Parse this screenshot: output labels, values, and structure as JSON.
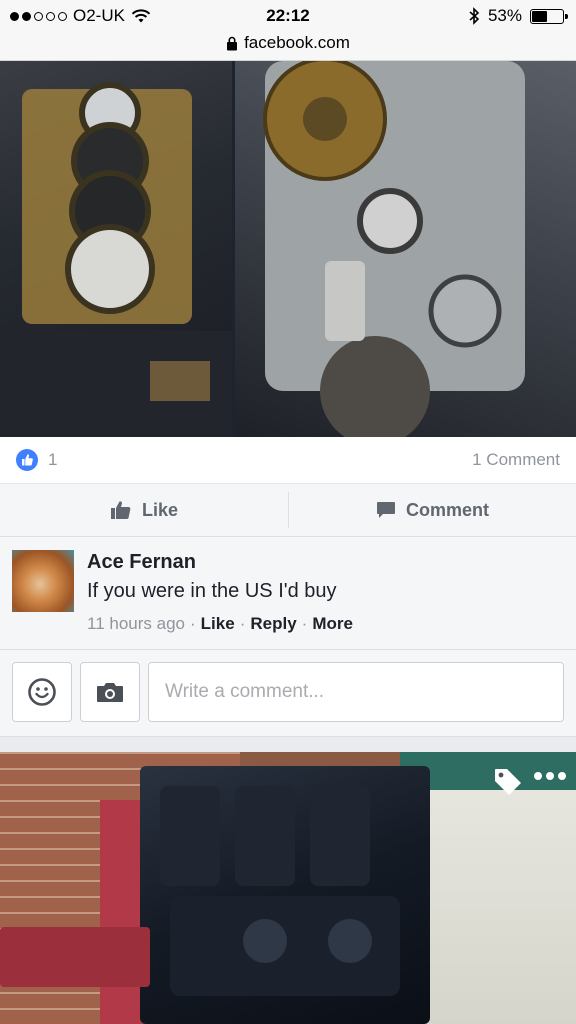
{
  "status_bar": {
    "carrier": "O2-UK",
    "signal_bars_filled": 2,
    "signal_bars_total": 5,
    "time": "22:12",
    "battery_percent": "53%",
    "battery_level": 0.53
  },
  "url_bar": {
    "domain": "facebook.com"
  },
  "post": {
    "reaction_count": "1",
    "comment_count_label": "1 Comment",
    "like_label": "Like",
    "comment_label": "Comment"
  },
  "comment": {
    "author": "Ace Fernan",
    "text": "If you were in the US I'd buy",
    "time": "11 hours ago",
    "like_label": "Like",
    "reply_label": "Reply",
    "more_label": "More"
  },
  "composer": {
    "placeholder": "Write a comment..."
  },
  "icons": {
    "wifi": "wifi-icon",
    "lock": "lock-icon",
    "bluetooth": "bluetooth-icon",
    "battery": "battery-icon",
    "like_badge": "thumbs-up-icon",
    "emoji": "smiley-icon",
    "camera": "camera-icon",
    "tag": "tag-icon",
    "more": "more-dots-icon"
  },
  "colors": {
    "facebook_blue": "#4080ff",
    "secondary_text": "#90949c",
    "action_text": "#606770"
  }
}
